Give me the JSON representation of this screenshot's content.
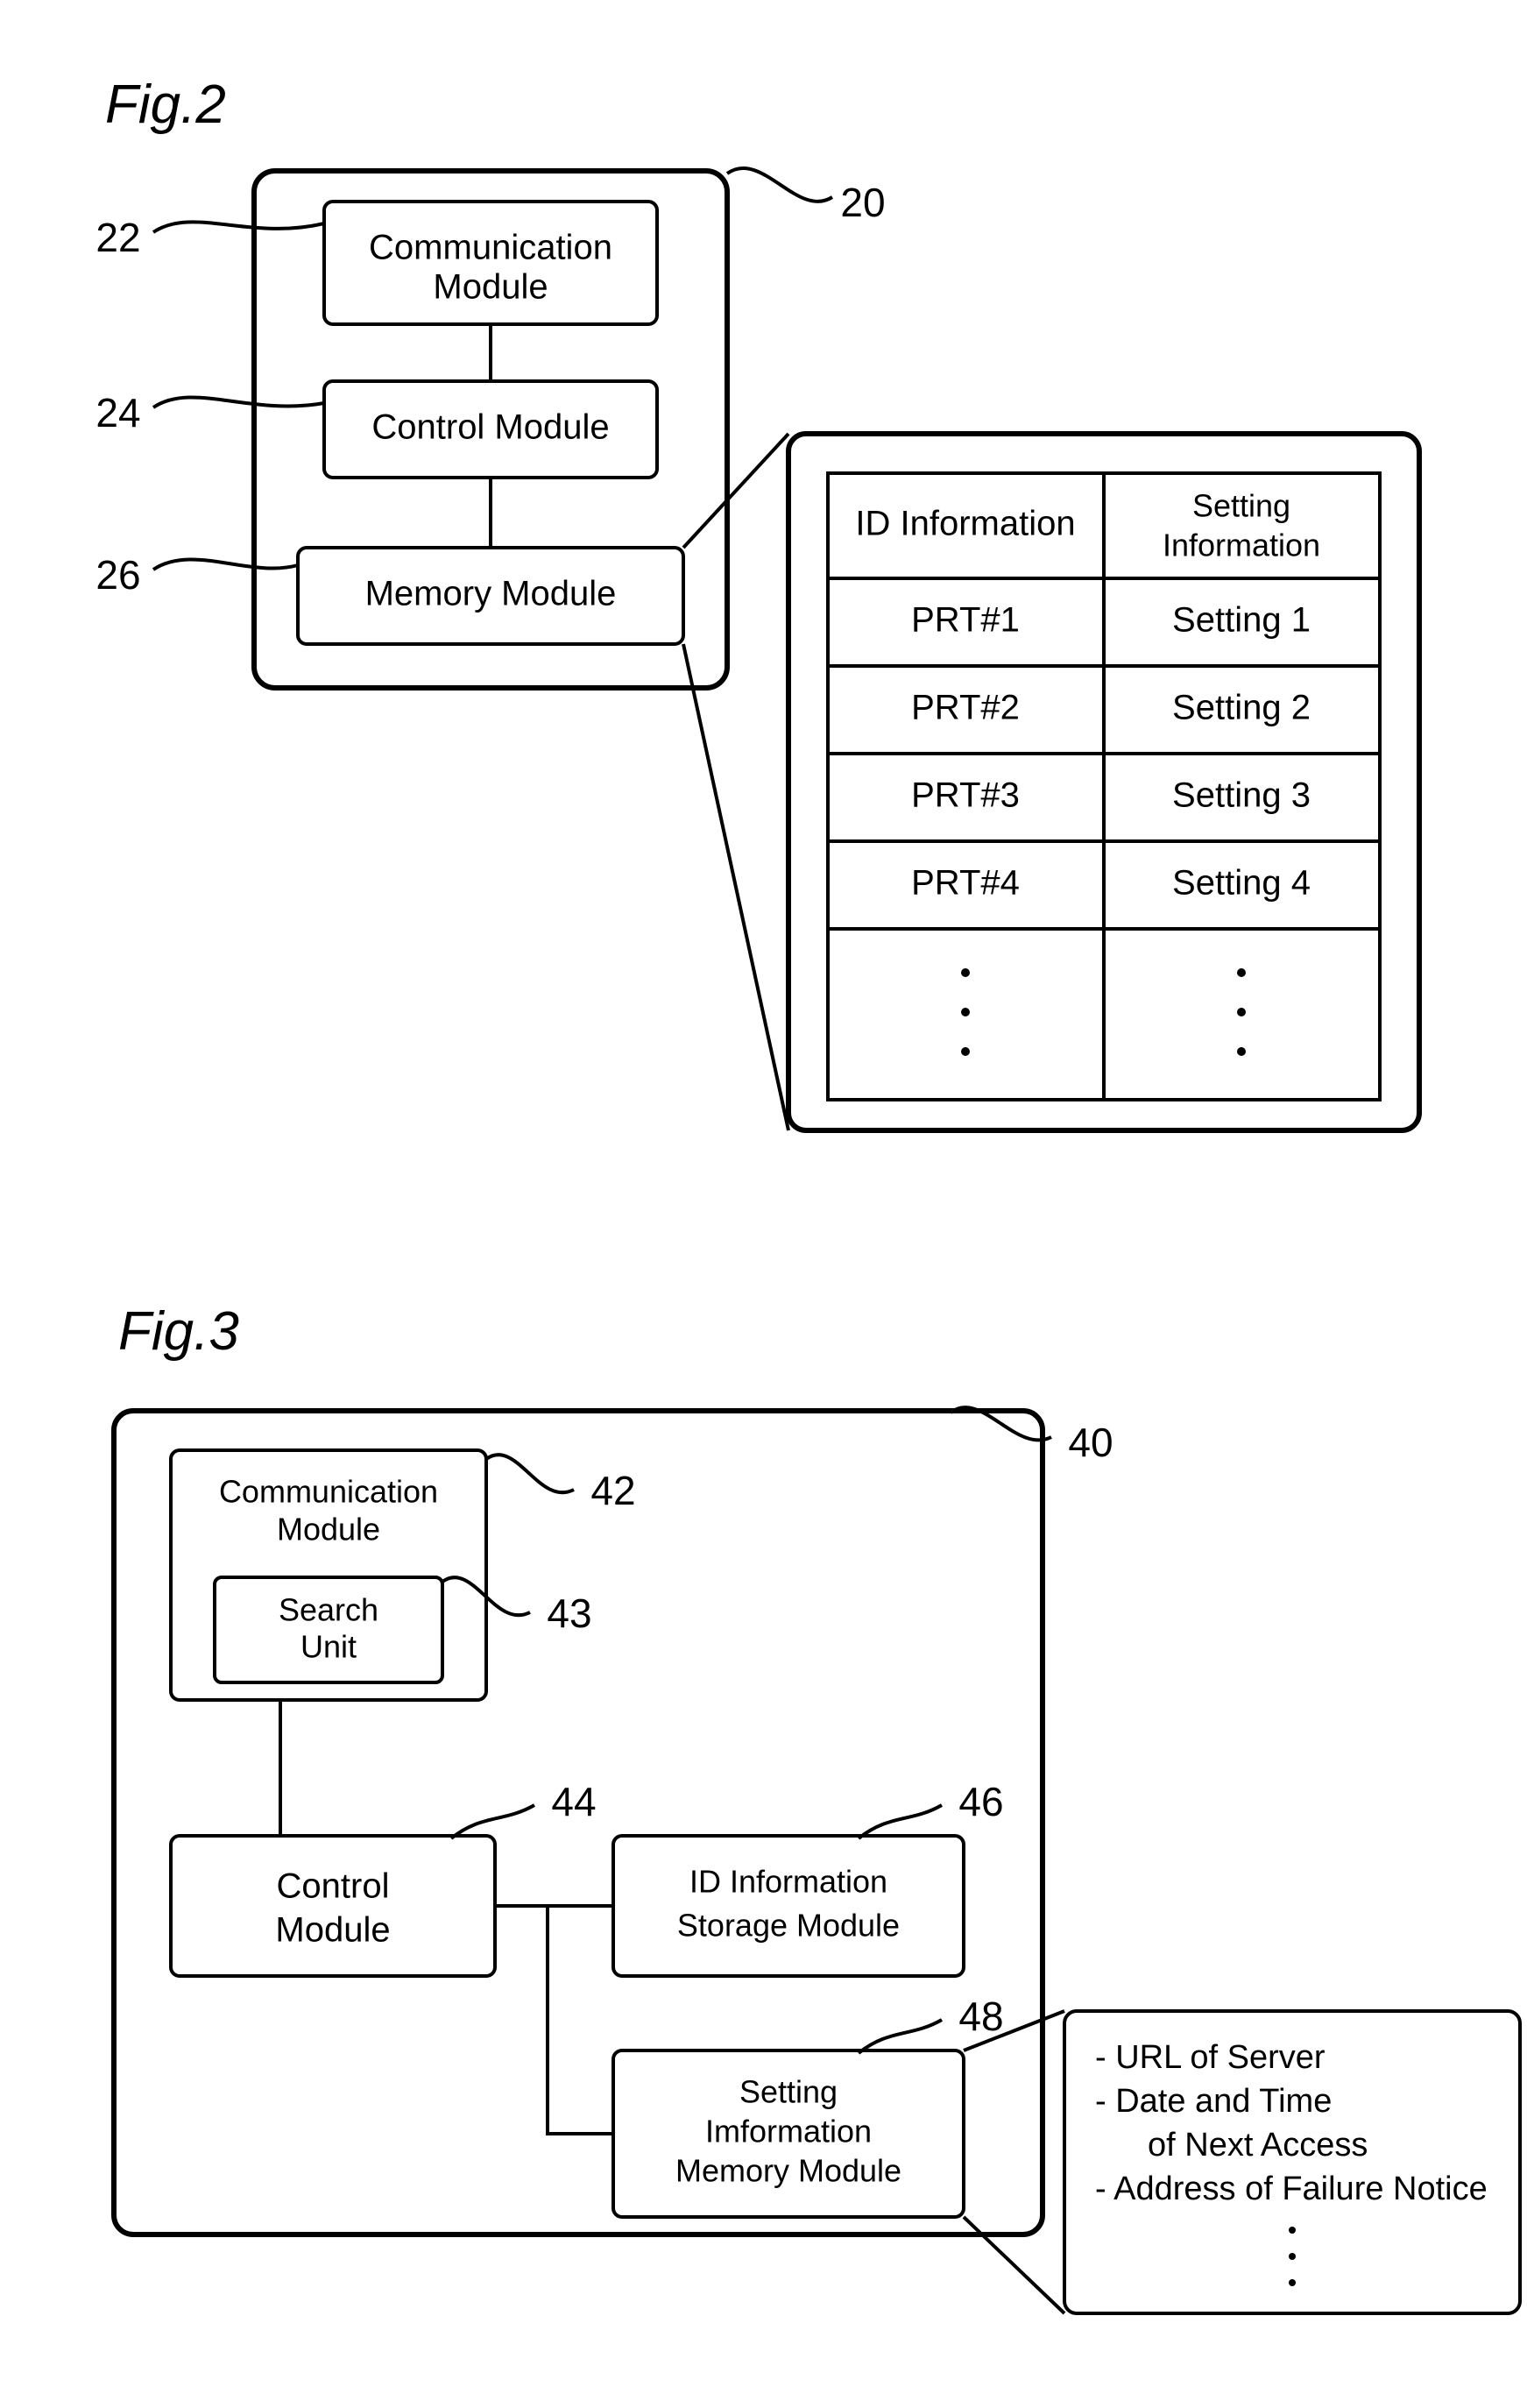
{
  "fig2": {
    "title": "Fig.2",
    "refs": {
      "r20": "20",
      "r22": "22",
      "r24": "24",
      "r26": "26"
    },
    "blocks": {
      "comm1": "Communication",
      "comm2": "Module",
      "ctrl": "Control Module",
      "mem": "Memory Module"
    },
    "table": {
      "head1": "ID Information",
      "head2a": "Setting",
      "head2b": "Information",
      "rows": [
        {
          "id": "PRT#1",
          "setting": "Setting 1"
        },
        {
          "id": "PRT#2",
          "setting": "Setting 2"
        },
        {
          "id": "PRT#3",
          "setting": "Setting 3"
        },
        {
          "id": "PRT#4",
          "setting": "Setting 4"
        }
      ]
    }
  },
  "fig3": {
    "title": "Fig.3",
    "refs": {
      "r40": "40",
      "r42": "42",
      "r43": "43",
      "r44": "44",
      "r46": "46",
      "r48": "48"
    },
    "blocks": {
      "comm1": "Communication",
      "comm2": "Module",
      "search1": "Search",
      "search2": "Unit",
      "ctrl1": "Control",
      "ctrl2": "Module",
      "idinfo1": "ID Information",
      "idinfo2": "Storage Module",
      "setmem1": "Setting",
      "setmem2": "Imformation",
      "setmem3": "Memory Module"
    },
    "list": {
      "i1": "- URL of Server",
      "i2": "- Date and Time",
      "i2b": "of Next Access",
      "i3": "- Address of Failure Notice"
    }
  }
}
